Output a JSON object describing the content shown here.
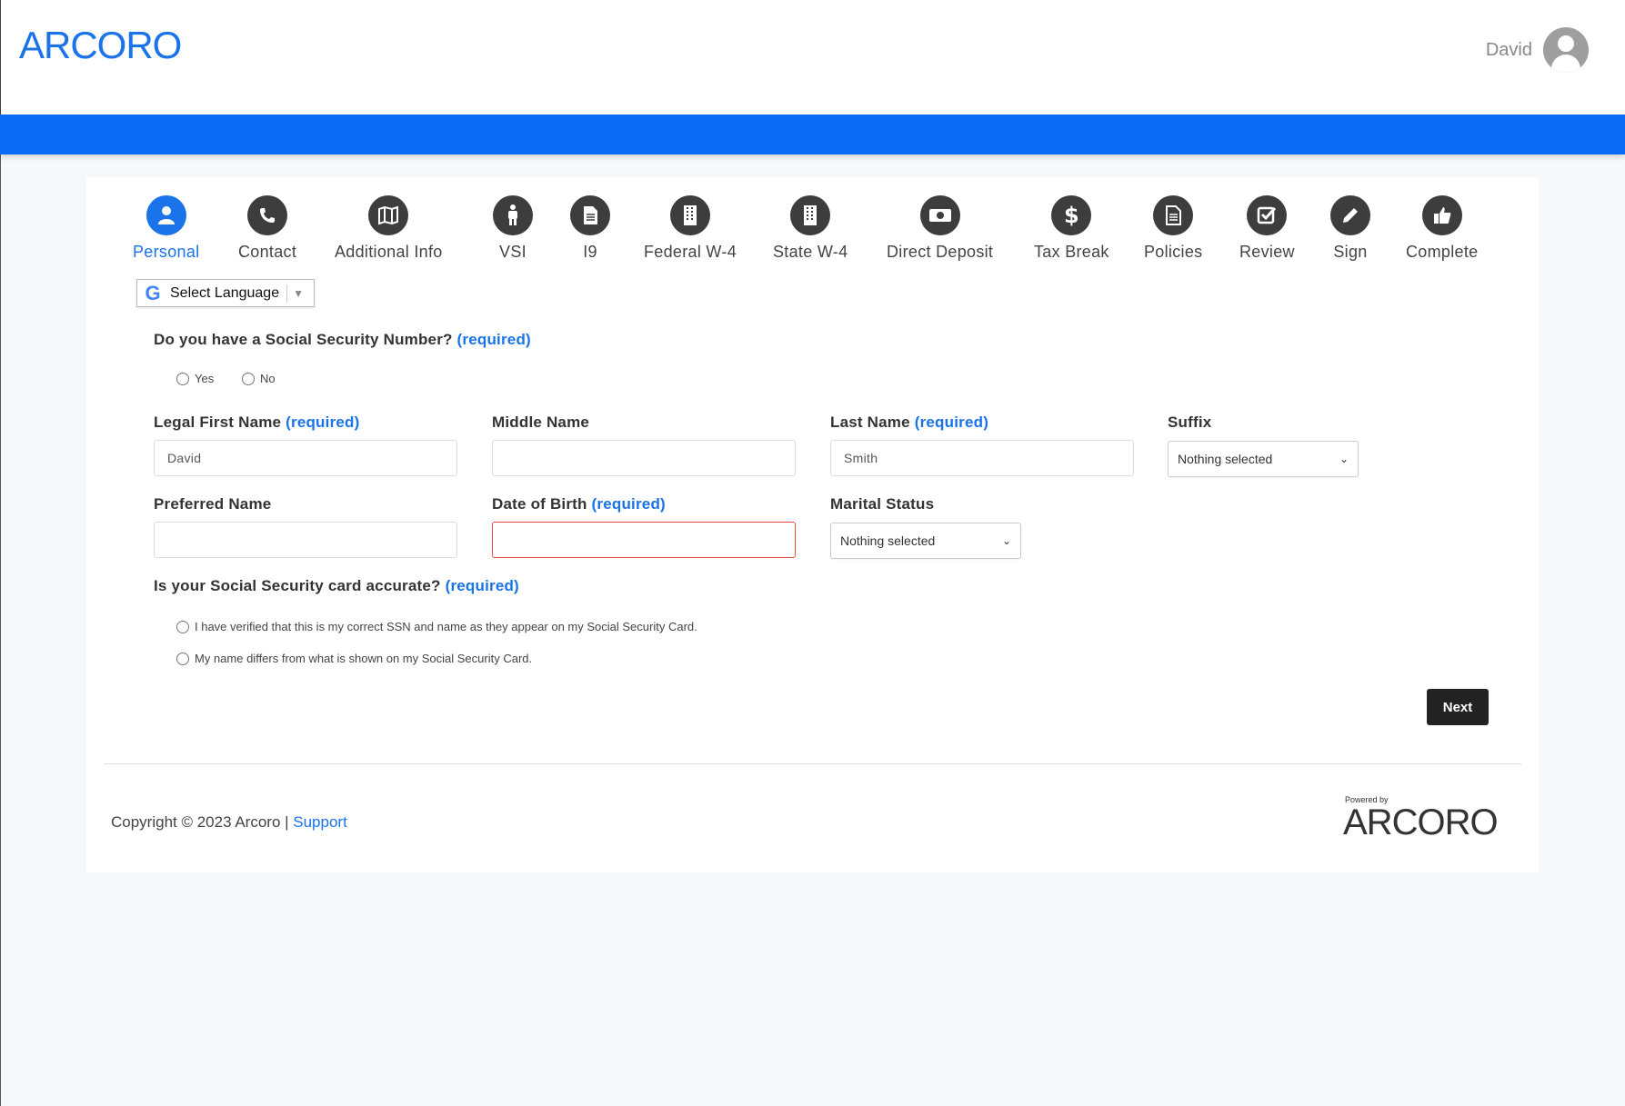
{
  "header": {
    "logo": "ARCORO",
    "user_name": "David"
  },
  "steps": [
    {
      "label": "Personal",
      "icon": "user-icon",
      "active": true
    },
    {
      "label": "Contact",
      "icon": "phone-icon",
      "active": false
    },
    {
      "label": "Additional Info",
      "icon": "map-icon",
      "active": false
    },
    {
      "label": "VSI",
      "icon": "person-icon",
      "active": false
    },
    {
      "label": "I9",
      "icon": "document-icon",
      "active": false
    },
    {
      "label": "Federal W-4",
      "icon": "building-icon",
      "active": false
    },
    {
      "label": "State W-4",
      "icon": "building-icon",
      "active": false
    },
    {
      "label": "Direct Deposit",
      "icon": "money-icon",
      "active": false
    },
    {
      "label": "Tax Break",
      "icon": "dollar-icon",
      "active": false
    },
    {
      "label": "Policies",
      "icon": "document-icon",
      "active": false
    },
    {
      "label": "Review",
      "icon": "checkbox-icon",
      "active": false
    },
    {
      "label": "Sign",
      "icon": "pencil-icon",
      "active": false
    },
    {
      "label": "Complete",
      "icon": "thumbs-up-icon",
      "active": false
    }
  ],
  "language": {
    "label": "Select Language"
  },
  "form": {
    "ssn_question": "Do you have a Social Security Number?",
    "required": "(required)",
    "yes": "Yes",
    "no": "No",
    "first_name_label": "Legal First Name",
    "first_name_value": "David",
    "middle_name_label": "Middle Name",
    "middle_name_value": "",
    "last_name_label": "Last Name",
    "last_name_value": "Smith",
    "suffix_label": "Suffix",
    "suffix_value": "Nothing selected",
    "preferred_name_label": "Preferred Name",
    "preferred_name_value": "",
    "dob_label": "Date of Birth",
    "dob_value": "",
    "marital_label": "Marital Status",
    "marital_value": "Nothing selected",
    "card_question": "Is your Social Security card accurate?",
    "card_option_1": "I have verified that this is my correct SSN and name as they appear on my Social Security Card.",
    "card_option_2": "My name differs from what is shown on my Social Security Card.",
    "next_label": "Next"
  },
  "footer": {
    "copyright": "Copyright © 2023 Arcoro | ",
    "support": "Support",
    "powered_by": "Powered by",
    "powered_logo": "ARCORO"
  },
  "colors": {
    "accent": "#1a73e8",
    "bar": "#0a6cf5",
    "error": "#e74c3c",
    "button": "#222222"
  }
}
